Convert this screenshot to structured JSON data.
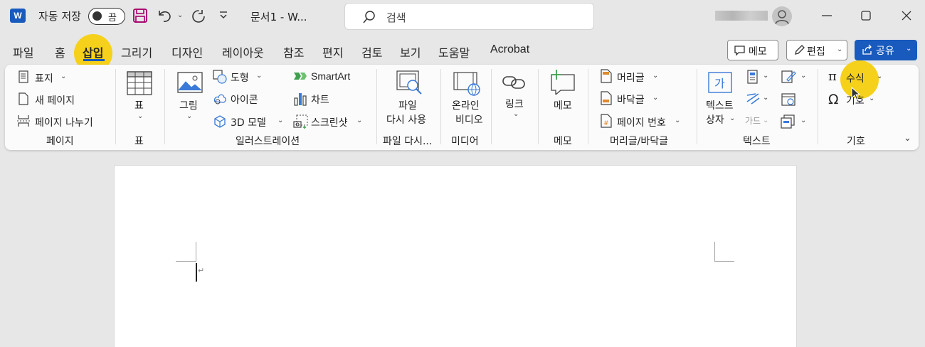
{
  "titlebar": {
    "app_logo": "W",
    "autosave_label": "자동 저장",
    "autosave_state": "끔",
    "doc_title": "문서1  -  W...",
    "search_placeholder": "검색",
    "icons": [
      "save-icon",
      "undo-icon",
      "redo-icon",
      "customize-qat-icon",
      "search-icon",
      "minimize-icon",
      "maximize-icon",
      "close-icon"
    ]
  },
  "menu": {
    "tabs": [
      "파일",
      "홈",
      "삽입",
      "그리기",
      "디자인",
      "레이아웃",
      "참조",
      "편지",
      "검토",
      "보기",
      "도움말",
      "Acrobat"
    ],
    "active_tab": "삽입",
    "memo_button": "메모",
    "edit_button": "편집",
    "share_button": "공유",
    "highlight_color": "#f5d11b",
    "accent_color": "#185abd"
  },
  "ribbon": {
    "pages": {
      "items": [
        "표지",
        "새 페이지",
        "페이지 나누기"
      ],
      "label": "페이지"
    },
    "table": {
      "button": "표",
      "label": "표"
    },
    "illustrations": {
      "picture": "그림",
      "shapes": "도형",
      "icons": "아이콘",
      "model3d": "3D 모델",
      "smartart": "SmartArt",
      "chart": "차트",
      "screenshot": "스크린샷",
      "label": "일러스트레이션"
    },
    "reuse": {
      "line1": "파일",
      "line2": "다시 사용",
      "label": "파일 다시..."
    },
    "media": {
      "line1": "온라인",
      "line2": "비디오",
      "label": "미디어"
    },
    "links": {
      "button": "링크"
    },
    "comments": {
      "button": "메모",
      "label": "메모"
    },
    "header_footer": {
      "header": "머리글",
      "footer": "바닥글",
      "page_number": "페이지 번호",
      "label": "머리글/바닥글"
    },
    "text": {
      "textbox_line1": "텍스트",
      "textbox_line2": "상자",
      "dropcap": "가드",
      "label": "텍스트"
    },
    "symbols": {
      "equation": "수식",
      "symbol": "기호",
      "label": "기호"
    }
  }
}
